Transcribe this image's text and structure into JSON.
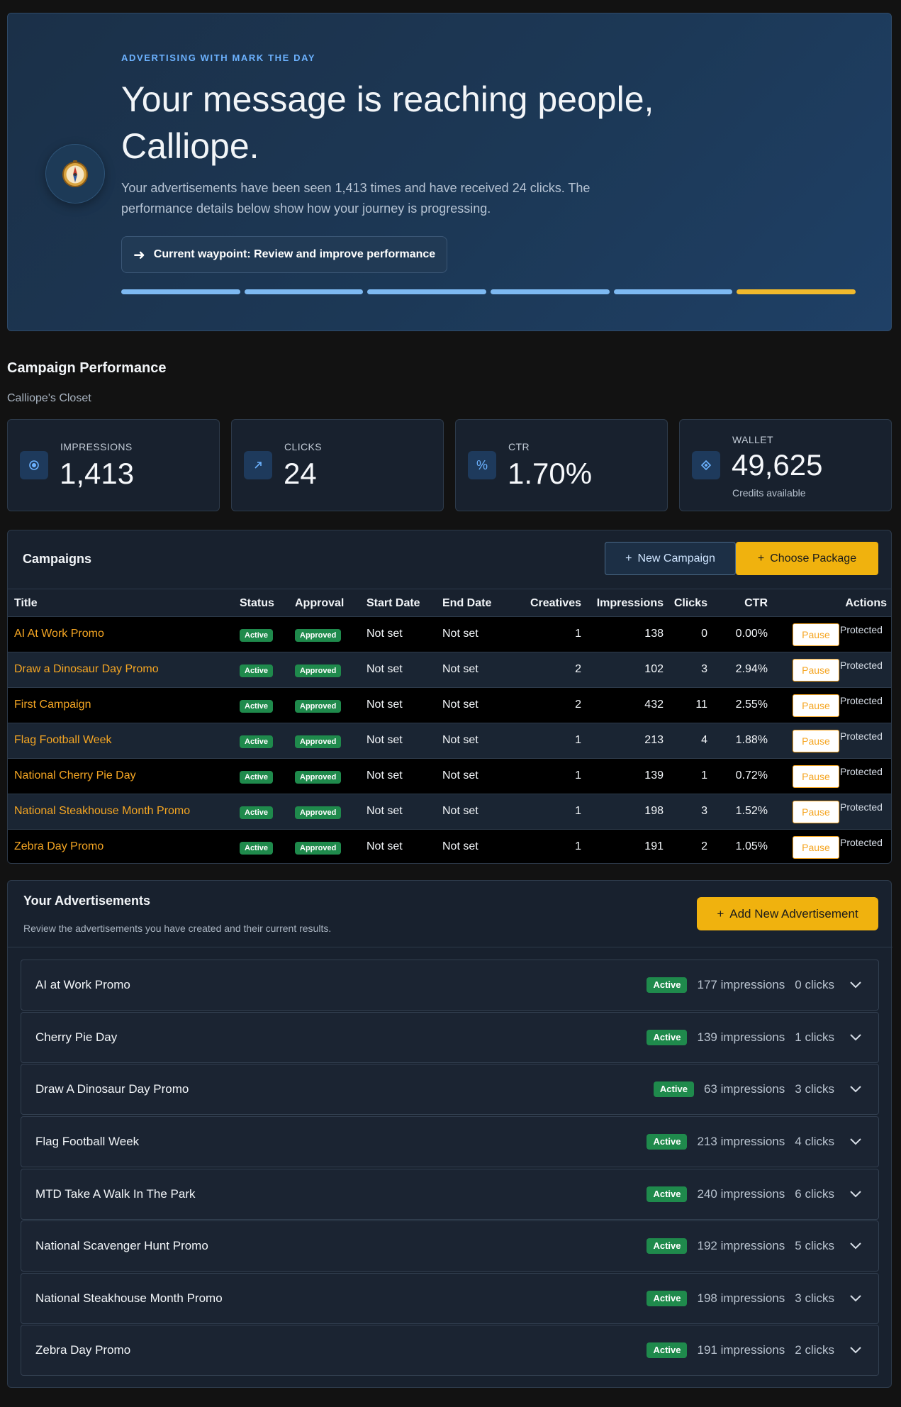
{
  "hero": {
    "eyebrow": "ADVERTISING WITH MARK THE DAY",
    "title": "Your message is reaching people, Calliope.",
    "description": "Your advertisements have been seen 1,413 times and have received 24 clicks. The performance details below show how your journey is progressing.",
    "waypoint_label": "Current waypoint: Review and improve performance",
    "icon": "compass-icon",
    "progress": {
      "total_steps": 6,
      "completed_steps": 5,
      "current_step": 6
    },
    "colors": {
      "accent": "#6cb2ff",
      "current_step": "#f0b92c",
      "completed_step": "#7db9f2"
    }
  },
  "performance": {
    "title": "Campaign Performance",
    "subtitle": "Calliope's Closet"
  },
  "stats": [
    {
      "label": "IMPRESSIONS",
      "value": "1,413",
      "icon": "eye-icon"
    },
    {
      "label": "CLICKS",
      "value": "24",
      "icon": "cursor-arrow-icon"
    },
    {
      "label": "CTR",
      "value": "1.70%",
      "icon": "percent-icon"
    },
    {
      "label": "WALLET",
      "value": "49,625",
      "sub": "Credits available",
      "icon": "diamond-icon"
    }
  ],
  "campaigns": {
    "title": "Campaigns",
    "new_button": "New Campaign",
    "package_button": "Choose Package",
    "columns": [
      "Title",
      "Status",
      "Approval",
      "Start Date",
      "End Date",
      "Creatives",
      "Impressions",
      "Clicks",
      "CTR",
      "Actions"
    ],
    "rows": [
      {
        "title": "AI At Work Promo",
        "status": "Active",
        "approval": "Approved",
        "start": "Not set",
        "end": "Not set",
        "creatives": "1",
        "impressions": "138",
        "clicks": "0",
        "ctr": "0.00%",
        "action": "Pause",
        "note": "Protected"
      },
      {
        "title": "Draw a Dinosaur Day Promo",
        "status": "Active",
        "approval": "Approved",
        "start": "Not set",
        "end": "Not set",
        "creatives": "2",
        "impressions": "102",
        "clicks": "3",
        "ctr": "2.94%",
        "action": "Pause",
        "note": "Protected"
      },
      {
        "title": "First Campaign",
        "status": "Active",
        "approval": "Approved",
        "start": "Not set",
        "end": "Not set",
        "creatives": "2",
        "impressions": "432",
        "clicks": "11",
        "ctr": "2.55%",
        "action": "Pause",
        "note": "Protected"
      },
      {
        "title": "Flag Football Week",
        "status": "Active",
        "approval": "Approved",
        "start": "Not set",
        "end": "Not set",
        "creatives": "1",
        "impressions": "213",
        "clicks": "4",
        "ctr": "1.88%",
        "action": "Pause",
        "note": "Protected"
      },
      {
        "title": "National Cherry Pie Day",
        "status": "Active",
        "approval": "Approved",
        "start": "Not set",
        "end": "Not set",
        "creatives": "1",
        "impressions": "139",
        "clicks": "1",
        "ctr": "0.72%",
        "action": "Pause",
        "note": "Protected"
      },
      {
        "title": "National Steakhouse Month Promo",
        "status": "Active",
        "approval": "Approved",
        "start": "Not set",
        "end": "Not set",
        "creatives": "1",
        "impressions": "198",
        "clicks": "3",
        "ctr": "1.52%",
        "action": "Pause",
        "note": "Protected"
      },
      {
        "title": "Zebra Day Promo",
        "status": "Active",
        "approval": "Approved",
        "start": "Not set",
        "end": "Not set",
        "creatives": "1",
        "impressions": "191",
        "clicks": "2",
        "ctr": "1.05%",
        "action": "Pause",
        "note": "Protected"
      }
    ]
  },
  "advertisements": {
    "title": "Your Advertisements",
    "subtitle": "Review the advertisements you have created and their current results.",
    "add_button": "Add New Advertisement",
    "items": [
      {
        "name": "AI at Work Promo",
        "status": "Active",
        "impressions": "177 impressions",
        "clicks": "0 clicks"
      },
      {
        "name": "Cherry Pie Day",
        "status": "Active",
        "impressions": "139 impressions",
        "clicks": "1 clicks"
      },
      {
        "name": "Draw A Dinosaur Day Promo",
        "status": "Active",
        "impressions": "63 impressions",
        "clicks": "3 clicks"
      },
      {
        "name": "Flag Football Week",
        "status": "Active",
        "impressions": "213 impressions",
        "clicks": "4 clicks"
      },
      {
        "name": "MTD Take A Walk In The Park",
        "status": "Active",
        "impressions": "240 impressions",
        "clicks": "6 clicks"
      },
      {
        "name": "National Scavenger Hunt Promo",
        "status": "Active",
        "impressions": "192 impressions",
        "clicks": "5 clicks"
      },
      {
        "name": "National Steakhouse Month Promo",
        "status": "Active",
        "impressions": "198 impressions",
        "clicks": "3 clicks"
      },
      {
        "name": "Zebra Day Promo",
        "status": "Active",
        "impressions": "191 impressions",
        "clicks": "2 clicks"
      }
    ]
  },
  "colors": {
    "background": "#121212",
    "panel": "#18212e",
    "campaign_title": "#f5a623",
    "primary_button": "#f0b20e",
    "status_green": "#1f8a4c"
  }
}
